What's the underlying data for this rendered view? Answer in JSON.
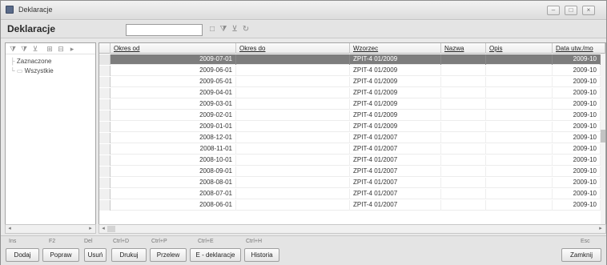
{
  "window": {
    "title": "Deklaracje"
  },
  "header": {
    "title": "Deklaracje",
    "search_value": ""
  },
  "tree": {
    "nodes": [
      "Zaznaczone",
      "Wszystkie"
    ]
  },
  "grid": {
    "columns": [
      "Okres od",
      "Okres do",
      "Wzorzec",
      "Nazwa",
      "Opis",
      "Data utw./mo"
    ],
    "rows": [
      {
        "okres_od": "2009-07-01",
        "okres_do": "",
        "wzorzec": "ZPIT-4 01/2009",
        "nazwa": "",
        "opis": "",
        "data": "2009-10"
      },
      {
        "okres_od": "2009-06-01",
        "okres_do": "",
        "wzorzec": "ZPIT-4 01/2009",
        "nazwa": "",
        "opis": "",
        "data": "2009-10"
      },
      {
        "okres_od": "2009-05-01",
        "okres_do": "",
        "wzorzec": "ZPIT-4 01/2009",
        "nazwa": "",
        "opis": "",
        "data": "2009-10"
      },
      {
        "okres_od": "2009-04-01",
        "okres_do": "",
        "wzorzec": "ZPIT-4 01/2009",
        "nazwa": "",
        "opis": "",
        "data": "2009-10"
      },
      {
        "okres_od": "2009-03-01",
        "okres_do": "",
        "wzorzec": "ZPIT-4 01/2009",
        "nazwa": "",
        "opis": "",
        "data": "2009-10"
      },
      {
        "okres_od": "2009-02-01",
        "okres_do": "",
        "wzorzec": "ZPIT-4 01/2009",
        "nazwa": "",
        "opis": "",
        "data": "2009-10"
      },
      {
        "okres_od": "2009-01-01",
        "okres_do": "",
        "wzorzec": "ZPIT-4 01/2009",
        "nazwa": "",
        "opis": "",
        "data": "2009-10"
      },
      {
        "okres_od": "2008-12-01",
        "okres_do": "",
        "wzorzec": "ZPIT-4 01/2007",
        "nazwa": "",
        "opis": "",
        "data": "2009-10"
      },
      {
        "okres_od": "2008-11-01",
        "okres_do": "",
        "wzorzec": "ZPIT-4 01/2007",
        "nazwa": "",
        "opis": "",
        "data": "2009-10"
      },
      {
        "okres_od": "2008-10-01",
        "okres_do": "",
        "wzorzec": "ZPIT-4 01/2007",
        "nazwa": "",
        "opis": "",
        "data": "2009-10"
      },
      {
        "okres_od": "2008-09-01",
        "okres_do": "",
        "wzorzec": "ZPIT-4 01/2007",
        "nazwa": "",
        "opis": "",
        "data": "2009-10"
      },
      {
        "okres_od": "2008-08-01",
        "okres_do": "",
        "wzorzec": "ZPIT-4 01/2007",
        "nazwa": "",
        "opis": "",
        "data": "2009-10"
      },
      {
        "okres_od": "2008-07-01",
        "okres_do": "",
        "wzorzec": "ZPIT-4 01/2007",
        "nazwa": "",
        "opis": "",
        "data": "2009-10"
      },
      {
        "okres_od": "2008-06-01",
        "okres_do": "",
        "wzorzec": "ZPIT-4 01/2007",
        "nazwa": "",
        "opis": "",
        "data": "2009-10"
      }
    ]
  },
  "footer": {
    "shortcuts": {
      "dodaj": "Ins",
      "popraw": "F2",
      "usun": "Del",
      "drukuj": "Ctrl+D",
      "przelew": "Ctrl+P",
      "edeklaracje": "Ctrl+E",
      "historia": "Ctrl+H",
      "zamknij": "Esc"
    },
    "buttons": {
      "dodaj": "Dodaj",
      "popraw": "Popraw",
      "usun": "Usuń",
      "drukuj": "Drukuj",
      "przelew": "Przelew",
      "edeklaracje": "E - deklaracje",
      "historia": "Historia",
      "zamknij": "Zamknij"
    }
  },
  "icons": {
    "app": "document-icon",
    "minimize": "minimize-icon",
    "maximize": "maximize-icon",
    "close": "close-icon",
    "filter": "filter-icon",
    "filter_remove": "filter-remove-icon",
    "refresh": "refresh-icon",
    "expand": "expand-all-icon",
    "collapse": "collapse-all-icon",
    "folder": "folder-icon"
  },
  "colors": {
    "selected_row": "#7d7d7d",
    "title_bg": "#e4e4e4",
    "border": "#a5a5a5"
  }
}
